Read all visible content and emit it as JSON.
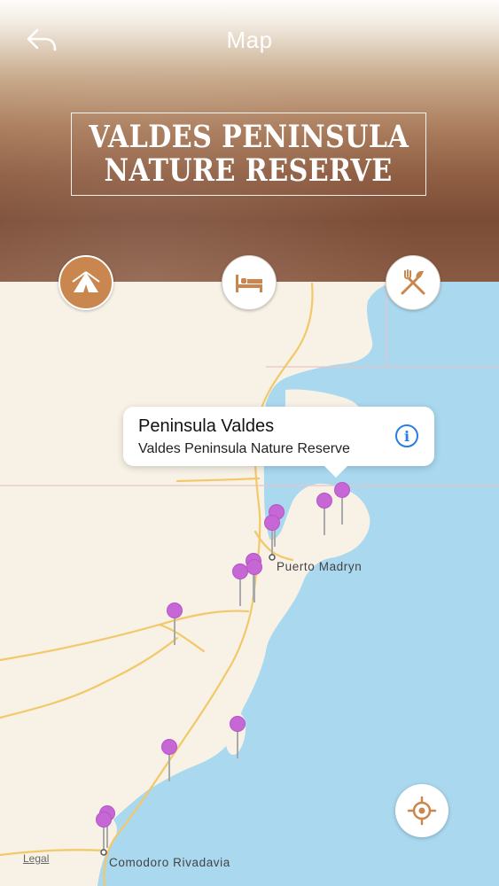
{
  "nav": {
    "title": "Map",
    "back_icon": "back-arrow-icon"
  },
  "header": {
    "title_line1": "VALDES PENINSULA",
    "title_line2": "NATURE RESERVE"
  },
  "categories": [
    {
      "name": "attractions",
      "icon": "tent-icon",
      "active": true
    },
    {
      "name": "hotels",
      "icon": "bed-icon",
      "active": false
    },
    {
      "name": "restaurants",
      "icon": "fork-knife-icon",
      "active": false
    }
  ],
  "callout": {
    "title": "Peninsula Valdes",
    "subtitle": "Valdes Peninsula Nature Reserve",
    "icon": "info-icon"
  },
  "map": {
    "labels": {
      "puerto_madryn": "Puerto Madryn",
      "comodoro_rivadavia": "Comodoro Rivadavia",
      "legal": "Legal"
    },
    "pin_color": "#c767d6",
    "water_color": "#a9d8ef",
    "land_color": "#f7f1e6",
    "road_color": "#f3c868"
  },
  "locate_icon": "locate-crosshair-icon",
  "colors": {
    "accent": "#c9874f",
    "info_blue": "#2a7de1"
  }
}
